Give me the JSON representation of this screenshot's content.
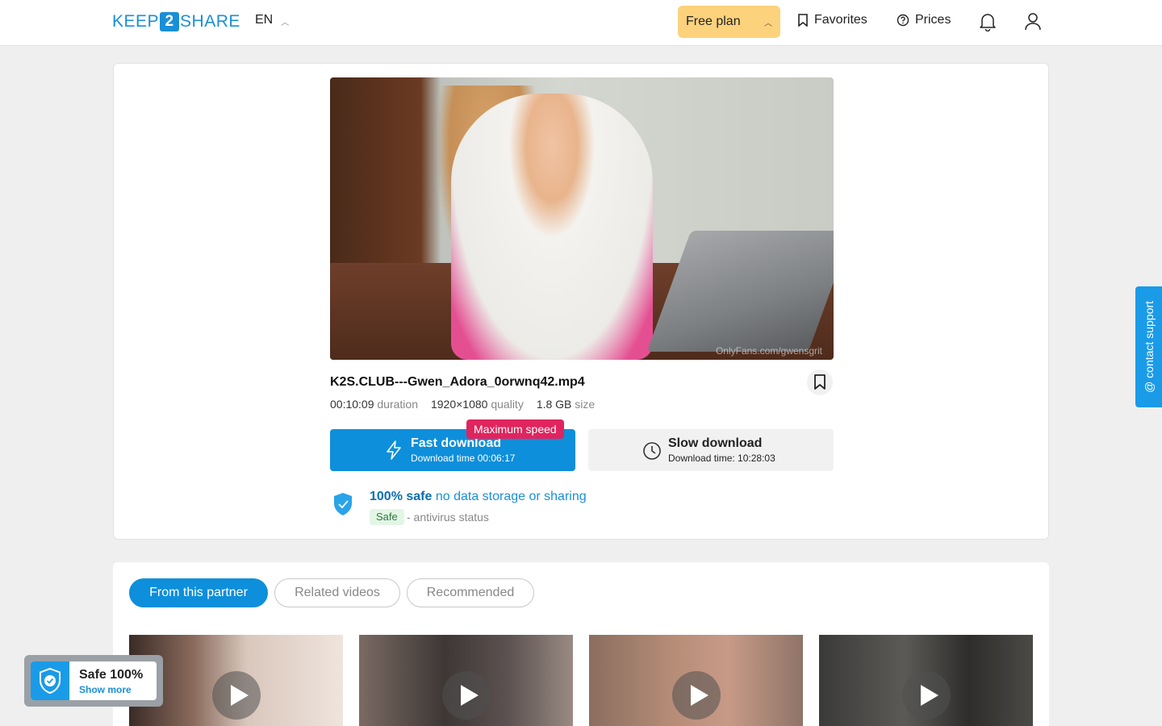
{
  "header": {
    "logo_left": "KEEP",
    "logo_mid": "2",
    "logo_right": "SHARE",
    "language": "EN",
    "plan_label": "Free plan",
    "favorites_label": "Favorites",
    "prices_label": "Prices"
  },
  "file": {
    "name": "K2S.CLUB---Gwen_Adora_0orwnq42.mp4",
    "duration": "00:10:09",
    "duration_label": "duration",
    "quality": "1920×1080",
    "quality_label": "quality",
    "size": "1.8 GB",
    "size_label": "size",
    "watermark": "OnlyFans.com/gwensgrit"
  },
  "download": {
    "fast_badge": "Maximum speed",
    "fast_label": "Fast download",
    "fast_time": "Download time 00:06:17",
    "slow_label": "Slow download",
    "slow_time": "Download time: 10:28:03"
  },
  "safety": {
    "strong": "100% safe",
    "rest": "no data storage or sharing",
    "tag": "Safe",
    "status": "- antivirus status"
  },
  "tabs": [
    "From this partner",
    "Related videos",
    "Recommended"
  ],
  "support_label": "@ contact support",
  "safe_widget": {
    "title": "Safe 100%",
    "link": "Show more"
  },
  "colors": {
    "accent": "#0d8fdb",
    "plan": "#fcd27c",
    "badge": "#e0245e"
  }
}
